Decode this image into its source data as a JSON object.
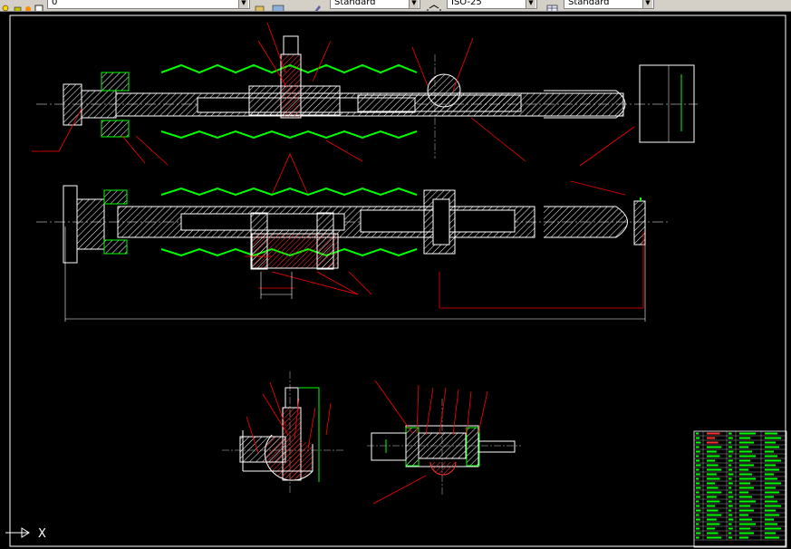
{
  "toolbar": {
    "layer_value": "0",
    "textstyle_value": "Standard",
    "dimstyle_value": "ISO-25",
    "tablestyle_value": "Standard"
  },
  "ucs": {
    "x_label": "X"
  },
  "colors": {
    "background": "#000000",
    "geometry": "#ffffff",
    "leaders": "#ff0000",
    "bellows": "#00ff00",
    "hatch": "#ffffff"
  }
}
